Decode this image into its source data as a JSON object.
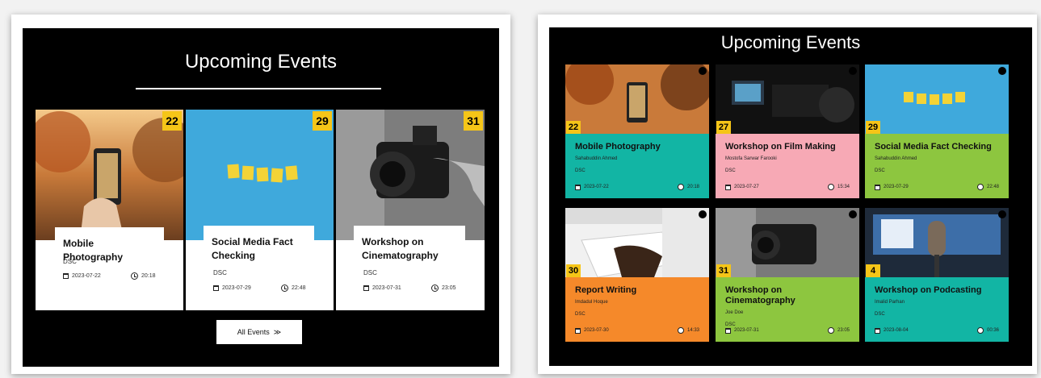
{
  "left_view": {
    "title": "Upcoming Events",
    "cards": [
      {
        "date": "22",
        "name": "Mobile Photography",
        "org": "DSC",
        "day": "2023-07-22",
        "time": "20:18"
      },
      {
        "date": "29",
        "name": "Social Media Fact Checking",
        "org": "DSC",
        "day": "2023-07-29",
        "time": "22:48"
      },
      {
        "date": "31",
        "name": "Workshop on Cinematography",
        "org": "DSC",
        "day": "2023-07-31",
        "time": "23:05"
      }
    ],
    "button": {
      "label": "All Events",
      "icon": "double-chevron-right-icon"
    }
  },
  "right_view": {
    "title": "Upcoming Events",
    "cards": [
      {
        "date": "22",
        "name": "Mobile Photography",
        "author": "Sahabuddin Ahmed",
        "org": "DSC",
        "day": "2023-07-22",
        "time": "20:18",
        "color": "#12b5a4"
      },
      {
        "date": "27",
        "name": "Workshop on Film Making",
        "author": "Mostofa Sarwar Farooki",
        "org": "DSC",
        "day": "2023-07-27",
        "time": "15:34",
        "color": "#f7a9b5"
      },
      {
        "date": "29",
        "name": "Social Media Fact Checking",
        "author": "Sahabuddin Ahmed",
        "org": "DSC",
        "day": "2023-07-29",
        "time": "22:48",
        "color": "#8dc63f"
      },
      {
        "date": "30",
        "name": "Report Writing",
        "author": "Imdadul Hoque",
        "org": "DSC",
        "day": "2023-07-30",
        "time": "14:33",
        "color": "#f5892a"
      },
      {
        "date": "31",
        "name": "Workshop on Cinematography",
        "author": "Joe Doe",
        "org": "DSC",
        "day": "2023-07-31",
        "time": "23:05",
        "color": "#8dc63f"
      },
      {
        "date": "4",
        "name": "Workshop on Podcasting",
        "author": "Imalid Parhan",
        "org": "DSC",
        "day": "2023-08-04",
        "time": "00:36",
        "color": "#12b5a4"
      }
    ]
  },
  "colors": {
    "accent": "#f5c518",
    "panel_bg": "#000000",
    "card_bg": "#ffffff"
  }
}
